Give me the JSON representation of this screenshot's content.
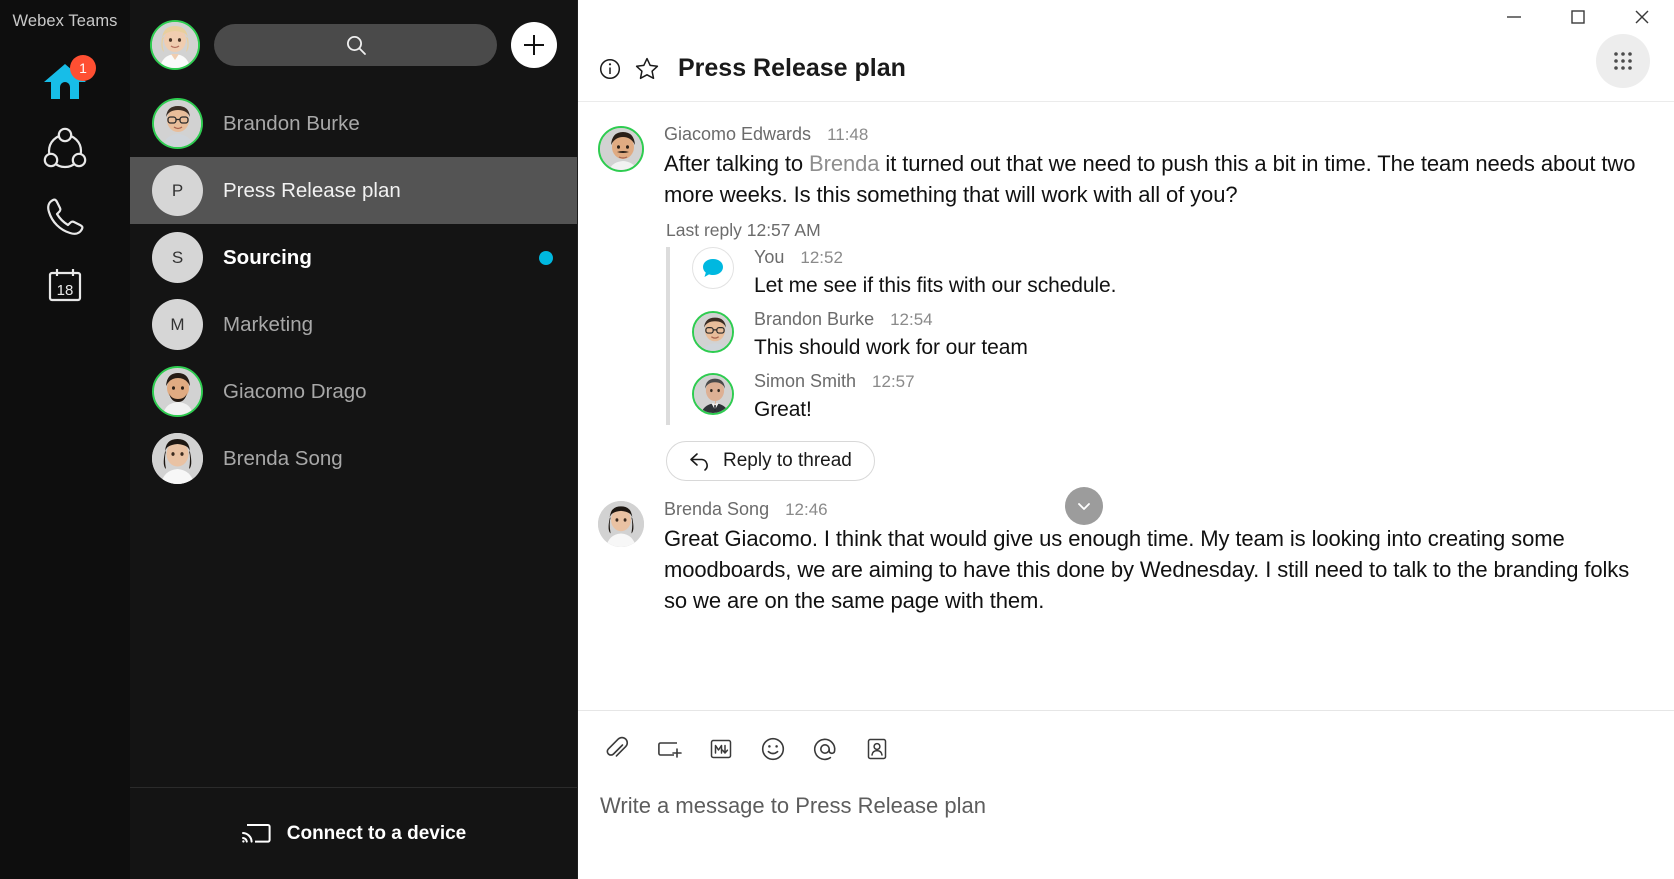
{
  "rail": {
    "title": "Webex Teams",
    "items": [
      {
        "name": "home-icon",
        "badge": "1"
      },
      {
        "name": "teams-icon",
        "badge": ""
      },
      {
        "name": "calls-icon",
        "badge": ""
      },
      {
        "name": "calendar-icon",
        "badge": "18"
      }
    ],
    "calendar_day": "18"
  },
  "spaces": {
    "search_placeholder": "",
    "add_label": "+",
    "items": [
      {
        "label": "Brandon Burke",
        "initial": "",
        "avatar": "photo-man-glasses",
        "selected": false,
        "unread": false,
        "presence": true
      },
      {
        "label": "Press Release plan",
        "initial": "P",
        "avatar": "initial",
        "selected": true,
        "unread": false,
        "presence": false
      },
      {
        "label": "Sourcing",
        "initial": "S",
        "avatar": "initial",
        "selected": false,
        "unread": true,
        "presence": false
      },
      {
        "label": "Marketing",
        "initial": "M",
        "avatar": "initial",
        "selected": false,
        "unread": false,
        "presence": false
      },
      {
        "label": "Giacomo Drago",
        "initial": "",
        "avatar": "photo-man-beard",
        "selected": false,
        "unread": false,
        "presence": true
      },
      {
        "label": "Brenda Song",
        "initial": "",
        "avatar": "photo-woman-dark",
        "selected": false,
        "unread": false,
        "presence": false
      }
    ],
    "connect_label": "Connect to a device"
  },
  "window": {
    "minimize": "minimize-icon",
    "maximize": "maximize-icon",
    "close": "close-icon"
  },
  "header": {
    "title": "Press Release plan",
    "info_icon": "info-icon",
    "favorite_icon": "star-icon",
    "apps_icon": "grid-apps-icon"
  },
  "conversation": {
    "messages": [
      {
        "author": "Giacomo Edwards",
        "time": "11:48",
        "avatar": "photo-man-moustache",
        "presence": true,
        "text_before": "After talking to ",
        "mention": "Brenda",
        "text_after": " it turned out that we need to push this a bit in time. The team needs about two more weeks. Is this something that will work with all of you?"
      }
    ],
    "last_reply_label": "Last reply 12:57 AM",
    "thread": [
      {
        "author": "You",
        "time": "12:52",
        "avatar": "you-bubble-icon",
        "presence": false,
        "text": "Let me see if this fits with our schedule."
      },
      {
        "author": "Brandon Burke",
        "time": "12:54",
        "avatar": "photo-man-glasses",
        "presence": true,
        "text": "This should work for our team"
      },
      {
        "author": "Simon Smith",
        "time": "12:57",
        "avatar": "photo-man-suit",
        "presence": true,
        "text": "Great!"
      }
    ],
    "reply_button": "Reply to thread",
    "final_message": {
      "author": "Brenda Song",
      "time": "12:46",
      "avatar": "photo-woman-dark",
      "presence": false,
      "text": "Great Giacomo. I think that would give us enough time. My team is looking into creating some moodboards, we are aiming to have this done by Wednesday. I still need to talk to the branding folks so we are on the same page with them."
    },
    "scroll_down_icon": "chevron-down-icon"
  },
  "composer": {
    "tools": [
      "attachment-icon",
      "screen-share-icon",
      "markdown-icon",
      "emoji-icon",
      "mention-icon",
      "person-card-icon"
    ],
    "placeholder": "Write a message to Press Release plan"
  },
  "colors": {
    "accent": "#00b8e0",
    "badge": "#ff4f32",
    "presence": "#2ecc50",
    "rail_bg": "#0e0e0e",
    "list_bg": "#141414",
    "selected_bg": "#545454"
  }
}
